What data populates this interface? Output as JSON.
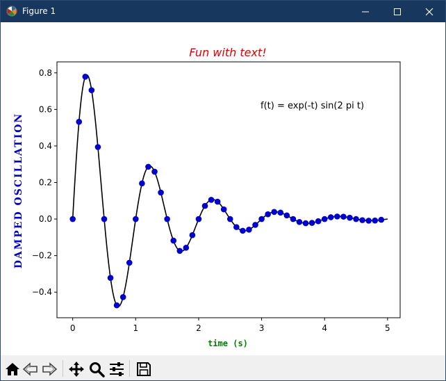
{
  "window": {
    "title": "Figure 1",
    "app_icon": "matplotlib-logo-icon",
    "buttons": [
      "minimize-icon",
      "maximize-icon",
      "close-icon"
    ]
  },
  "toolbar": {
    "icons": [
      "home-icon",
      "back-icon",
      "forward-icon",
      "pan-icon",
      "zoom-icon",
      "configure-subplots-icon",
      "save-icon"
    ]
  },
  "chart_data": {
    "type": "line",
    "title": "Fun with text!",
    "title_color": "#e00000",
    "xlabel": "time (s)",
    "xlabel_color": "#008000",
    "ylabel": "DAMPED OSCILLATION",
    "ylabel_color": "#0000c0",
    "annotation": "f(t) = exp(-t) sin(2 pi t)",
    "xlim": [
      -0.25,
      5.2
    ],
    "ylim": [
      -0.54,
      0.86
    ],
    "xticks": [
      "0",
      "1",
      "2",
      "3",
      "4",
      "5"
    ],
    "yticks": [
      "−0.4",
      "−0.2",
      "0.0",
      "0.2",
      "0.4",
      "0.6",
      "0.8"
    ],
    "legend": "none",
    "grid": false,
    "series": [
      {
        "style": "smooth-line",
        "color": "#000000",
        "function": "exp(-t)*sin(2*pi*t)",
        "x_range": [
          0,
          5
        ]
      },
      {
        "style": "points",
        "color": "#0000cc",
        "x": [
          0.0,
          0.1,
          0.2,
          0.3,
          0.4,
          0.5,
          0.6,
          0.7,
          0.8,
          0.9,
          1.0,
          1.1,
          1.2,
          1.3,
          1.4,
          1.5,
          1.6,
          1.7,
          1.8,
          1.9,
          2.0,
          2.1,
          2.2,
          2.3,
          2.4,
          2.5,
          2.6,
          2.7,
          2.8,
          2.9,
          3.0,
          3.1,
          3.2,
          3.3,
          3.4,
          3.5,
          3.6,
          3.7,
          3.8,
          3.9,
          4.0,
          4.1,
          4.2,
          4.3,
          4.4,
          4.5,
          4.6,
          4.7,
          4.8,
          4.9
        ],
        "y": [
          0.0,
          0.532,
          0.779,
          0.705,
          0.394,
          0.0,
          -0.322,
          -0.472,
          -0.427,
          -0.239,
          0.0,
          0.195,
          0.286,
          0.259,
          0.145,
          0.0,
          -0.118,
          -0.174,
          -0.157,
          -0.088,
          0.0,
          0.072,
          0.105,
          0.095,
          0.053,
          0.0,
          -0.044,
          -0.064,
          -0.058,
          -0.032,
          0.0,
          0.026,
          0.039,
          0.035,
          0.02,
          0.0,
          -0.016,
          -0.023,
          -0.021,
          -0.012,
          0.0,
          0.01,
          0.014,
          0.013,
          0.007,
          0.0,
          -0.006,
          -0.009,
          -0.008,
          -0.004
        ]
      }
    ]
  }
}
